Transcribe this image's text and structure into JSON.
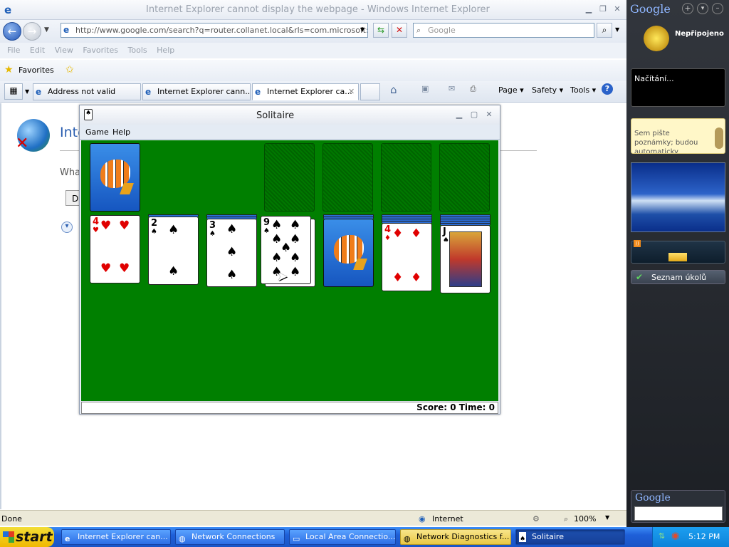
{
  "ie": {
    "title": "Internet Explorer cannot display the webpage - Windows Internet Explorer",
    "address": "http://www.google.com/search?q=router.collanet.local&rls=com.microsoft:en-us:",
    "search_placeholder": "Google",
    "menu": [
      "File",
      "Edit",
      "View",
      "Favorites",
      "Tools",
      "Help"
    ],
    "favorites_label": "Favorites",
    "tabs": [
      "Address not valid",
      "Internet Explorer cann...",
      "Internet Explorer ca..."
    ],
    "commands": {
      "page": "Page",
      "safety": "Safety",
      "tools": "Tools"
    },
    "page": {
      "heading": "Inte",
      "question": "Wha",
      "button_letter": "D"
    },
    "status": {
      "left": "Done",
      "zone": "Internet",
      "zoom": "100%"
    }
  },
  "solitaire": {
    "title": "Solitaire",
    "menu": [
      "Game",
      "Help"
    ],
    "score_text": "Score: 0 Time: 0",
    "tableau": [
      {
        "rank": "4",
        "suit": "♥",
        "color": "red"
      },
      {
        "rank": "2",
        "suit": "♠",
        "color": "black"
      },
      {
        "rank": "3",
        "suit": "♠",
        "color": "black"
      },
      {
        "rank": "9",
        "suit": "♠",
        "color": "black"
      },
      {
        "rank": "",
        "suit": "",
        "color": "back"
      },
      {
        "rank": "4",
        "suit": "♦",
        "color": "red"
      },
      {
        "rank": "J",
        "suit": "♠",
        "color": "black"
      }
    ]
  },
  "sidebar": {
    "logo": "Google",
    "weather_status": "Nepřipojeno",
    "loading": "Načítání...",
    "notes": "Sem pište poznámky; budou automaticky ukládány.",
    "tasks": "Seznam úkolů",
    "search_logo": "Google"
  },
  "taskbar": {
    "start": "start",
    "buttons": [
      "Internet Explorer can...",
      "Network Connections",
      "Local Area Connectio...",
      "Network Diagnostics f...",
      "Solitaire"
    ],
    "clock": "5:12 PM"
  },
  "colors": {
    "felt": "#007f00",
    "taskbar": "#245edb",
    "start": "#f0b800"
  }
}
